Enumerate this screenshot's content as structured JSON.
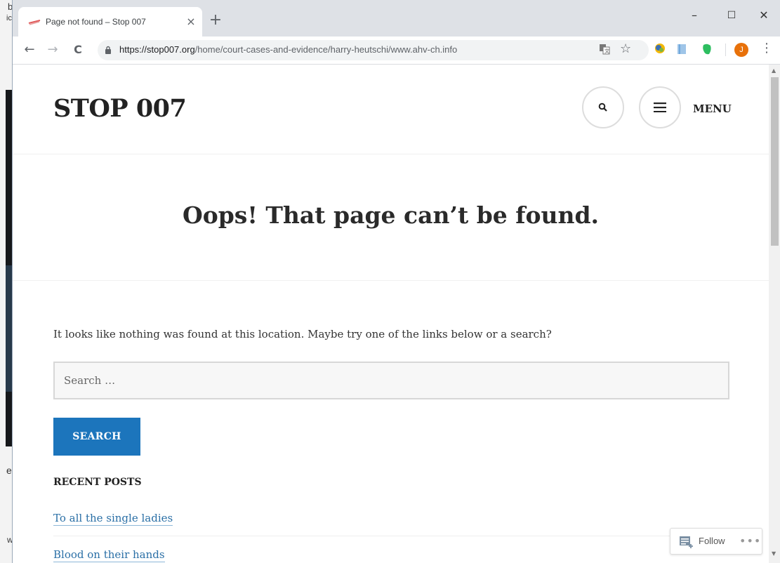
{
  "desktop": {
    "glyph_top": "b",
    "glyph_2": "ic",
    "glyph_mid": "e",
    "glyph_low": "w"
  },
  "browser": {
    "tab": {
      "title": "Page not found – Stop 007",
      "close_glyph": "×"
    },
    "new_tab_glyph": "+",
    "window_controls": {
      "minimize": "–",
      "maximize": "☐",
      "close": "✕"
    },
    "nav": {
      "back": "←",
      "forward": "→",
      "reload": "C"
    },
    "address": {
      "host": "https://stop007.org",
      "path": "/home/court-cases-and-evidence/harry-heutschi/www.ahv-ch.info"
    },
    "star_glyph": "☆",
    "profile_initial": "J",
    "menu_glyph": "⋮"
  },
  "site": {
    "title": "STOP 007",
    "menu_label": "MENU",
    "page_title": "Oops! That page can’t be found.",
    "notice": "It looks like nothing was found at this location. Maybe try one of the links below or a search?",
    "search": {
      "placeholder": "Search …",
      "button": "SEARCH"
    },
    "recent_posts": {
      "title": "RECENT POSTS",
      "items": [
        "To all the single ladies",
        "Blood on their hands"
      ]
    }
  },
  "follow": {
    "label": "Follow",
    "more": "•••"
  },
  "colors": {
    "accent": "#1c75bc",
    "link": "#2a6fa6",
    "tabstrip": "#dee1e6"
  }
}
